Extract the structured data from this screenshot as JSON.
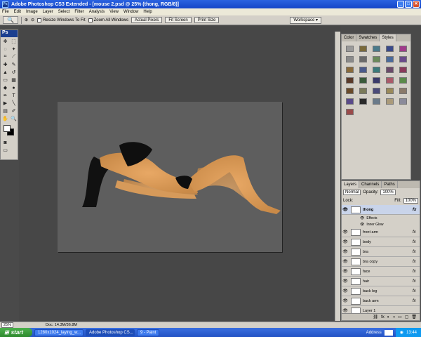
{
  "window": {
    "title": "Adobe Photoshop CS3 Extended - [mouse 2.psd @ 25% (thong, RGB/8)]",
    "app_icon": "ps-icon"
  },
  "menu": [
    "File",
    "Edit",
    "Image",
    "Layer",
    "Select",
    "Filter",
    "Analysis",
    "View",
    "Window",
    "Help"
  ],
  "options": {
    "resize_label": "Resize Windows To Fit",
    "zoom_all_label": "Zoom All Windows",
    "actual_pixels": "Actual Pixels",
    "fit_screen": "Fit Screen",
    "print_size": "Print Size",
    "workspace": "Workspace ▾"
  },
  "tools_panel": {
    "logo": "Ps"
  },
  "swatch_panel": {
    "tabs": [
      "Color",
      "Swatches",
      "Styles"
    ],
    "active_tab": "Styles",
    "swatches": [
      "#9a9a9a",
      "#7a6a3a",
      "#4a7a8a",
      "#3a4a8a",
      "#a03a8a",
      "#8a8a8a",
      "#6a6a6a",
      "#6a8a5a",
      "#4a6a9a",
      "#6a4a8a",
      "#8a6a3a",
      "#4a5a8a",
      "#3a7a7a",
      "#6a4a6a",
      "#8a3a5a",
      "#5a3a2a",
      "#3a5a3a",
      "#3a3a6a",
      "#aa5a6a",
      "#5a8a4a",
      "#6a4a2a",
      "#7a7a5a",
      "#4a4a7a",
      "#9a8a5a",
      "#8a7a6a",
      "#5a4a8a",
      "#2a2a2a",
      "#6a7a8a",
      "#aa9a7a",
      "#8a8a9a",
      "#9a4a4a"
    ]
  },
  "layers_panel": {
    "tabs": [
      "Layers",
      "Channels",
      "Paths"
    ],
    "blend_mode": "Normal",
    "opacity_label": "Opacity:",
    "opacity": "100%",
    "lock_label": "Lock:",
    "fill_label": "Fill:",
    "fill": "100%",
    "layers": [
      {
        "name": "thong",
        "selected": true,
        "fx": "fx"
      },
      {
        "name": "front arm",
        "selected": false,
        "fx": "fx"
      },
      {
        "name": "body",
        "selected": false,
        "fx": "fx"
      },
      {
        "name": "bra",
        "selected": false,
        "fx": "fx"
      },
      {
        "name": "bra copy",
        "selected": false,
        "fx": "fx"
      },
      {
        "name": "face",
        "selected": false,
        "fx": "fx"
      },
      {
        "name": "hair",
        "selected": false,
        "fx": "fx"
      },
      {
        "name": "back leg",
        "selected": false,
        "fx": "fx"
      },
      {
        "name": "back arm",
        "selected": false,
        "fx": "fx"
      },
      {
        "name": "Layer 1",
        "selected": false,
        "fx": ""
      }
    ],
    "effects_label": "Effects",
    "inner_glow_label": "Inner Glow"
  },
  "status": {
    "zoom": "25%",
    "doc": "Doc: 14.3M/36.8M"
  },
  "taskbar": {
    "start": "start",
    "tasks": [
      "1280x1024_laying_w...",
      "Adobe Photoshop CS...",
      "9 - Paint"
    ],
    "address_label": "Address",
    "clock": "13:44"
  }
}
